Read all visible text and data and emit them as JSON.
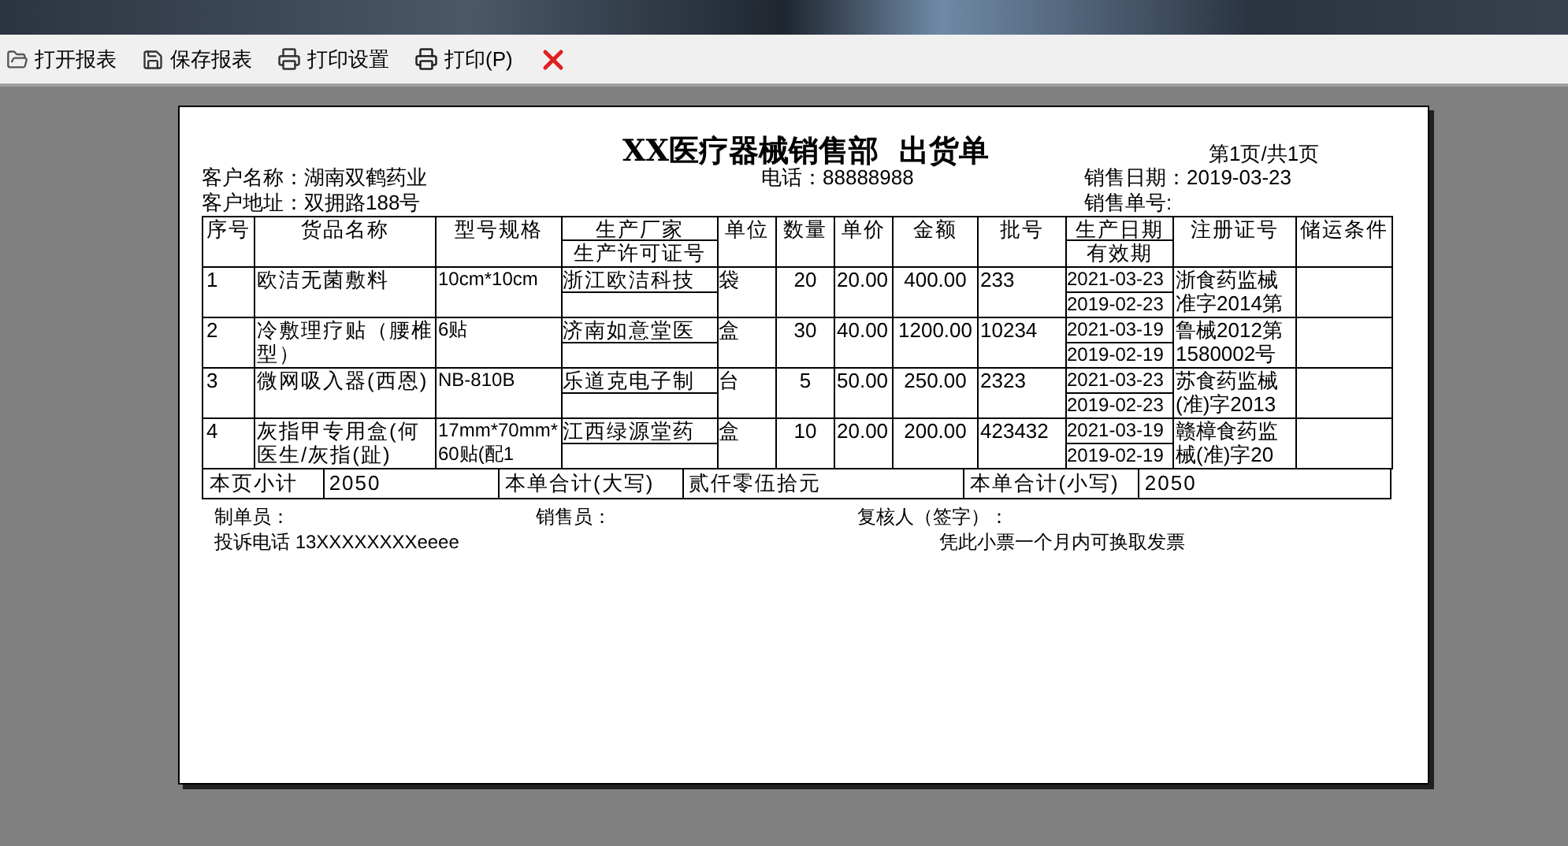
{
  "toolbar": [
    {
      "kind": "open",
      "label": "打开报表"
    },
    {
      "kind": "save",
      "label": "保存报表"
    },
    {
      "kind": "print-setup",
      "label": "打印设置"
    },
    {
      "kind": "print",
      "label": "打印(P)"
    },
    {
      "kind": "close"
    }
  ],
  "report": {
    "title": "XX医疗器械销售部  出货单",
    "page_info": "第1页/共1页",
    "customer_name": "客户名称：湖南双鹤药业",
    "phone": "电话：88888988",
    "sale_date": "销售日期：2019-03-23",
    "customer_address": "客户地址：双拥路188号",
    "order_no": "销售单号:",
    "columns": [
      {
        "label": "序号"
      },
      {
        "label": "货品名称"
      },
      {
        "label": "型号规格"
      },
      {
        "label": "生产厂家",
        "sublabel": "生产许可证号"
      },
      {
        "label": "单位"
      },
      {
        "label": "数量"
      },
      {
        "label": "单价"
      },
      {
        "label": "金额"
      },
      {
        "label": "批号"
      },
      {
        "label": "生产日期",
        "sublabel": "有效期"
      },
      {
        "label": "注册证号"
      },
      {
        "label": "储运条件"
      }
    ],
    "rows": [
      {
        "no": "1",
        "name": "欧洁无菌敷料",
        "spec": "10cm*10cm",
        "maker": "浙江欧洁科技",
        "unit": "袋",
        "qty": "20",
        "price": "20.00",
        "amount": "400.00",
        "batch": "233",
        "prod_date": "2021-03-23",
        "expiry": "2019-02-23",
        "reg_no": "浙食药监械准字2014第"
      },
      {
        "no": "2",
        "name": "冷敷理疗贴（腰椎型）",
        "spec": "6贴",
        "maker": "济南如意堂医",
        "unit": "盒",
        "qty": "30",
        "price": "40.00",
        "amount": "1200.00",
        "batch": "10234",
        "prod_date": "2021-03-19",
        "expiry": "2019-02-19",
        "reg_no": "鲁械2012第1580002号"
      },
      {
        "no": "3",
        "name": "微网吸入器(西恩)",
        "spec": "NB-810B",
        "maker": "乐道克电子制",
        "unit": "台",
        "qty": "5",
        "price": "50.00",
        "amount": "250.00",
        "batch": "2323",
        "prod_date": "2021-03-23",
        "expiry": "2019-02-23",
        "reg_no": "苏食药监械(准)字2013"
      },
      {
        "no": "4",
        "name": "灰指甲专用盒(何医生/灰指(趾)",
        "spec": "17mm*70mm*60贴(配1",
        "maker": "江西绿源堂药",
        "unit": "盒",
        "qty": "10",
        "price": "20.00",
        "amount": "200.00",
        "batch": "423432",
        "prod_date": "2021-03-19",
        "expiry": "2019-02-19",
        "reg_no": "赣樟食药监械(准)字20"
      }
    ],
    "footer": [
      {
        "label": "本页小计",
        "value": "2050"
      },
      {
        "label": "本单合计(大写)",
        "value": "贰仟零伍拾元"
      },
      {
        "label": "本单合计(小写)",
        "value": "2050"
      }
    ],
    "signatures": [
      "制单员：",
      "销售员：",
      "复核人（签字）："
    ],
    "complaint": "投诉电话 13XXXXXXXXeeee",
    "note": "凭此小票一个月内可换取发票"
  }
}
